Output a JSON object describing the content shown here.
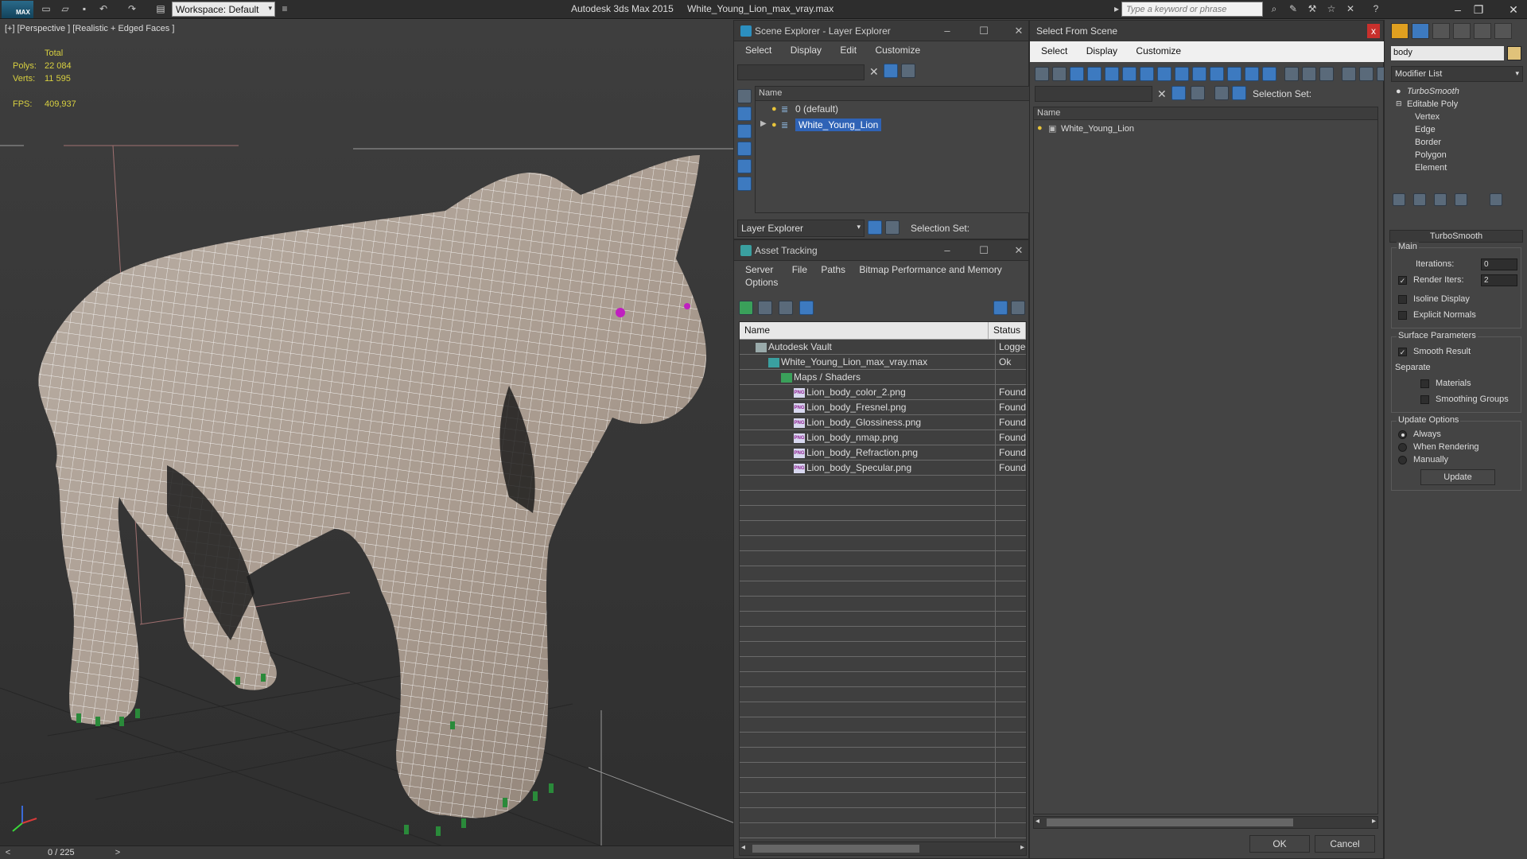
{
  "titlebar": {
    "logo": "MAX",
    "workspace": "Workspace: Default",
    "app_name": "Autodesk 3ds Max 2015",
    "file_name": "White_Young_Lion_max_vray.max",
    "search_placeholder": "Type a keyword or phrase"
  },
  "viewport": {
    "label": "[+] [Perspective ] [Realistic + Edged Faces ]",
    "stats": {
      "total_label": "Total",
      "polys_label": "Polys:",
      "polys_value": "22 084",
      "verts_label": "Verts:",
      "verts_value": "11 595",
      "fps_label": "FPS:",
      "fps_value": "409,937"
    }
  },
  "timeline": {
    "frame": "0 / 225"
  },
  "scene_explorer": {
    "title": "Scene Explorer - Layer Explorer",
    "menu": [
      "Select",
      "Display",
      "Edit",
      "Customize"
    ],
    "column_name": "Name",
    "layers": [
      {
        "name": "0 (default)",
        "selected": false
      },
      {
        "name": "White_Young_Lion",
        "selected": true
      }
    ],
    "bottom_dropdown": "Layer Explorer",
    "selection_set_label": "Selection Set:"
  },
  "asset_tracking": {
    "title": "Asset Tracking",
    "menu_row1": [
      "Server",
      "File",
      "Paths",
      "Bitmap Performance and Memory"
    ],
    "menu_row2": [
      "Options"
    ],
    "columns": [
      "Name",
      "Status"
    ],
    "rows": [
      {
        "name": "Autodesk Vault",
        "status": "Logged",
        "indent": 0,
        "icon": "vault"
      },
      {
        "name": "White_Young_Lion_max_vray.max",
        "status": "Ok",
        "indent": 1,
        "icon": "max"
      },
      {
        "name": "Maps / Shaders",
        "status": "",
        "indent": 2,
        "icon": "maps"
      },
      {
        "name": "Lion_body_color_2.png",
        "status": "Found",
        "indent": 3,
        "icon": "png"
      },
      {
        "name": "Lion_body_Fresnel.png",
        "status": "Found",
        "indent": 3,
        "icon": "png"
      },
      {
        "name": "Lion_body_Glossiness.png",
        "status": "Found",
        "indent": 3,
        "icon": "png"
      },
      {
        "name": "Lion_body_nmap.png",
        "status": "Found",
        "indent": 3,
        "icon": "png"
      },
      {
        "name": "Lion_body_Refraction.png",
        "status": "Found",
        "indent": 3,
        "icon": "png"
      },
      {
        "name": "Lion_body_Specular.png",
        "status": "Found",
        "indent": 3,
        "icon": "png"
      }
    ]
  },
  "select_from_scene": {
    "title": "Select From Scene",
    "menu": [
      "Select",
      "Display",
      "Customize"
    ],
    "selection_set_label": "Selection Set:",
    "column_name": "Name",
    "objects": [
      "White_Young_Lion"
    ],
    "ok_label": "OK",
    "cancel_label": "Cancel"
  },
  "command_panel": {
    "object_name": "body",
    "object_color": "#e0c27a",
    "modifier_list": "Modifier List",
    "stack": [
      {
        "label": "TurboSmooth",
        "sub": false
      },
      {
        "label": "Editable Poly",
        "sub": false
      },
      {
        "label": "Vertex",
        "sub": true
      },
      {
        "label": "Edge",
        "sub": true
      },
      {
        "label": "Border",
        "sub": true
      },
      {
        "label": "Polygon",
        "sub": true
      },
      {
        "label": "Element",
        "sub": true
      }
    ],
    "turbosmooth": {
      "title": "TurboSmooth",
      "main_label": "Main",
      "iterations_label": "Iterations:",
      "iterations_value": "0",
      "render_iters_label": "Render Iters:",
      "render_iters_value": "2",
      "isoline_label": "Isoline Display",
      "explicit_label": "Explicit Normals",
      "surface_label": "Surface Parameters",
      "smooth_label": "Smooth Result",
      "separate_label": "Separate",
      "materials_label": "Materials",
      "smoothing_groups_label": "Smoothing Groups",
      "update_options_label": "Update Options",
      "always_label": "Always",
      "when_rendering_label": "When Rendering",
      "manually_label": "Manually",
      "update_button": "Update"
    }
  }
}
